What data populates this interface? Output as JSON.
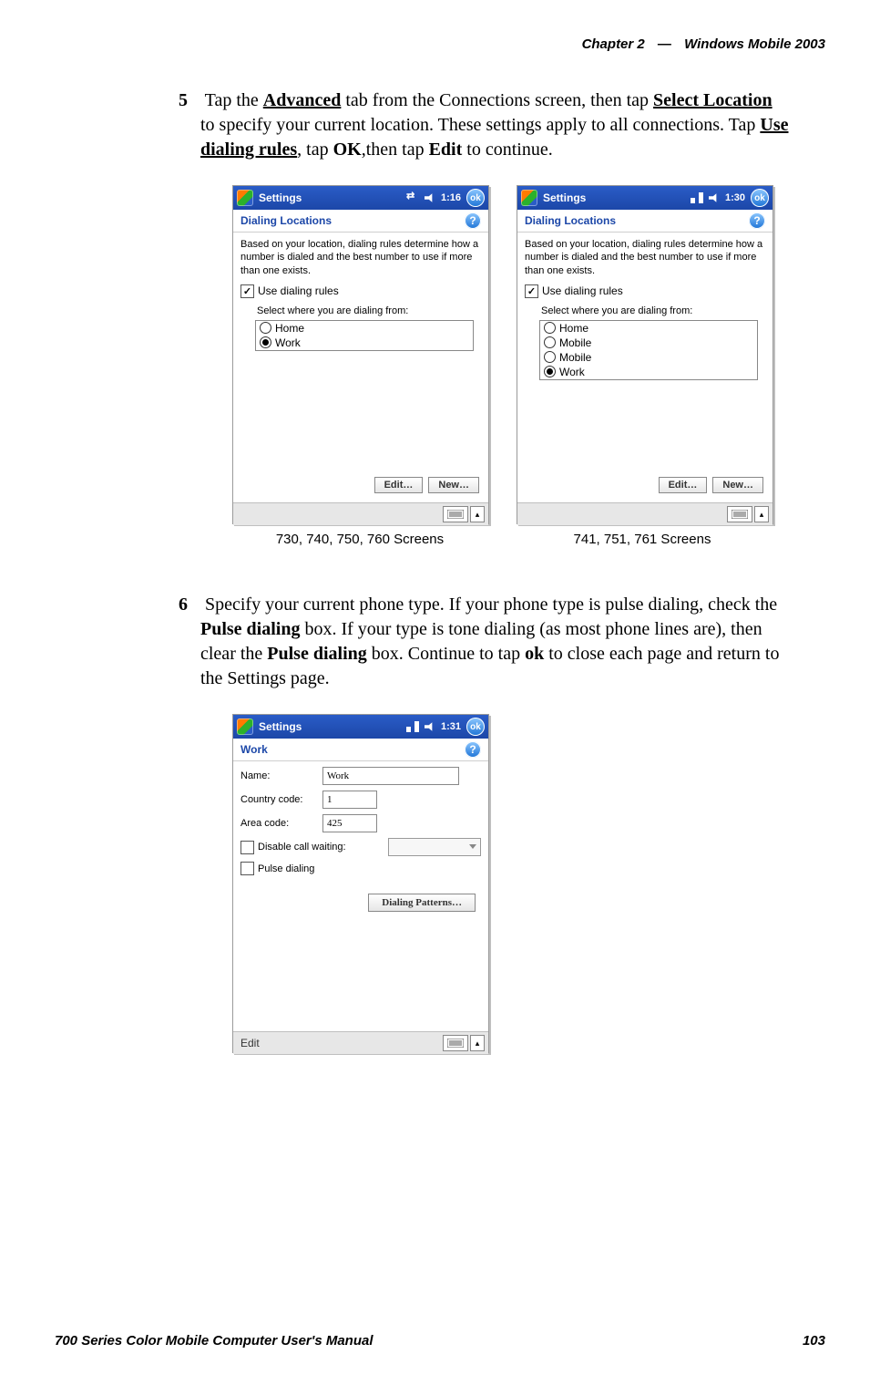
{
  "header": {
    "chapter": "Chapter 2",
    "dash": "—",
    "title": "Windows Mobile 2003"
  },
  "step5": {
    "num": "5",
    "seg1": "Tap the ",
    "advanced": "Advanced",
    "seg2": " tab from the Connections screen, then tap ",
    "selectLocation": "Select Location",
    "seg3": " to specify your current location. These settings apply to all connections. Tap ",
    "useRules": "Use dialing rules",
    "seg4": ", tap ",
    "ok": "OK",
    "seg5": ",then tap ",
    "edit": "Edit",
    "seg6": " to continue."
  },
  "step6": {
    "num": "6",
    "seg1": "Specify your current phone type. If your phone type is pulse dialing, check the ",
    "pd1": "Pulse dialing",
    "seg2": " box. If your type is tone dialing (as most phone lines are), then clear the ",
    "pd2": "Pulse dialing",
    "seg3": " box. Continue to tap ",
    "ok": "ok",
    "seg4": " to close each page and return to the Settings page."
  },
  "captions": {
    "left": "730, 740, 750, 760 Screens",
    "right": "741, 751, 761 Screens"
  },
  "footer": {
    "left": "700 Series Color Mobile Computer User's Manual",
    "right": "103"
  },
  "screen1": {
    "taskbarTitle": "Settings",
    "time": "1:16",
    "ok": "ok",
    "panelTitle": "Dialing Locations",
    "desc": "Based on your location, dialing rules determine how a number is dialed and the best number to use if more than one exists.",
    "useRules": "Use dialing rules",
    "selectLabel": "Select where you are dialing from:",
    "options": [
      "Home",
      "Work"
    ],
    "selectedIndex": 1,
    "editBtn": "Edit…",
    "newBtn": "New…"
  },
  "screen2": {
    "taskbarTitle": "Settings",
    "time": "1:30",
    "ok": "ok",
    "panelTitle": "Dialing Locations",
    "desc": "Based on your location, dialing rules determine how a number is dialed and the best number to use if more than one exists.",
    "useRules": "Use dialing rules",
    "selectLabel": "Select where you are dialing from:",
    "options": [
      "Home",
      "Mobile",
      "Mobile",
      "Work"
    ],
    "selectedIndex": 3,
    "editBtn": "Edit…",
    "newBtn": "New…"
  },
  "screen3": {
    "taskbarTitle": "Settings",
    "time": "1:31",
    "ok": "ok",
    "panelTitle": "Work",
    "nameLabel": "Name:",
    "nameValue": "Work",
    "ccLabel": "Country code:",
    "ccValue": "1",
    "acLabel": "Area code:",
    "acValue": "425",
    "disableCW": "Disable call waiting:",
    "pulse": "Pulse dialing",
    "patternsBtn": "Dialing Patterns…",
    "bottomLabel": "Edit"
  }
}
